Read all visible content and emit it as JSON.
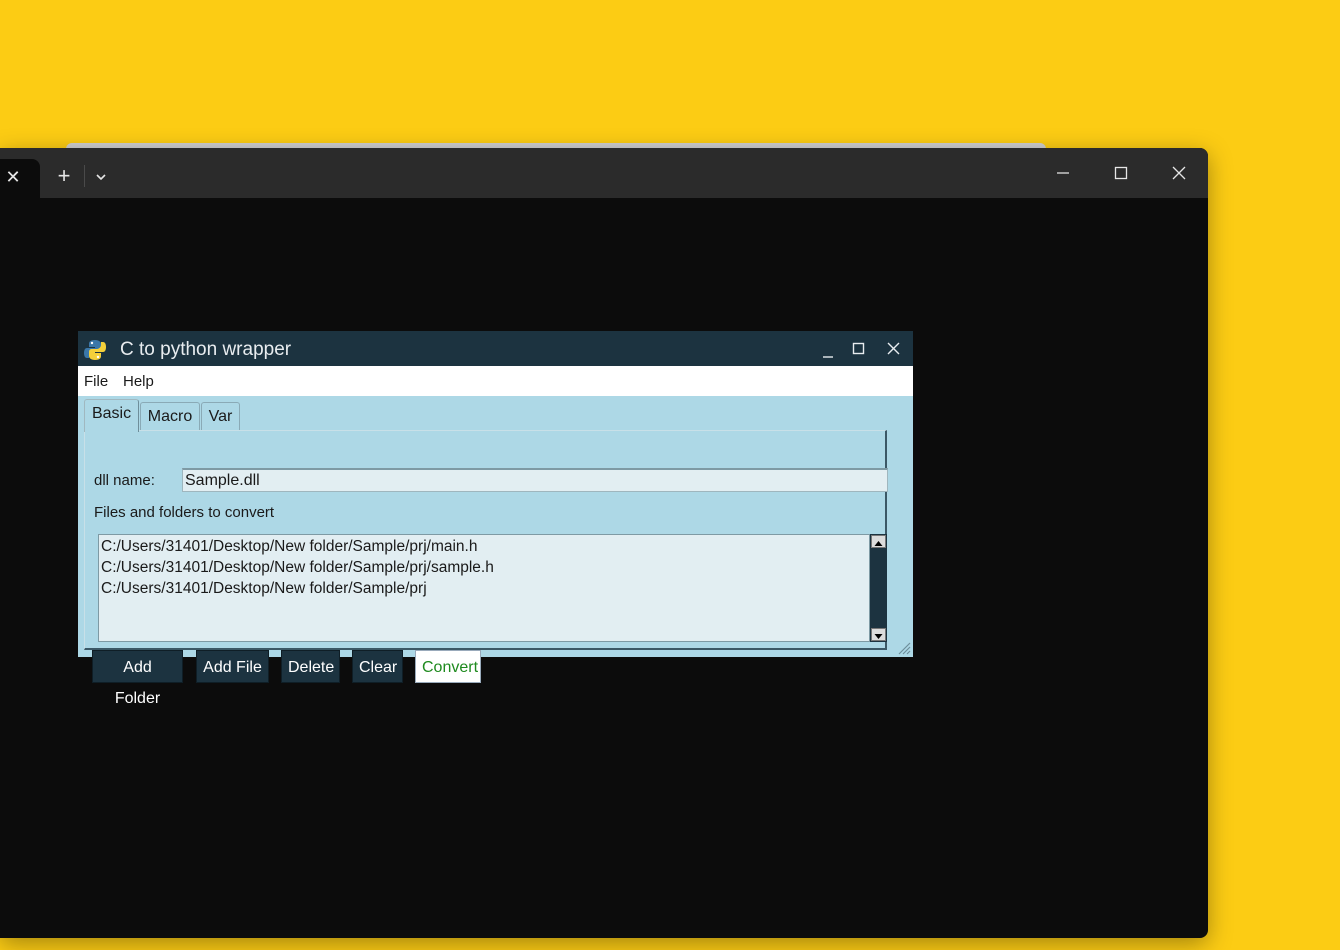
{
  "terminal": {
    "tab_close_glyph": "✕",
    "new_tab_glyph": "+",
    "controls": [
      "minimize-icon",
      "maximize-icon",
      "close-icon"
    ]
  },
  "app": {
    "title": "C to python wrapper",
    "menu": [
      "File",
      "Help"
    ],
    "tabs": [
      "Basic",
      "Macro",
      "Var"
    ],
    "active_tab": "Basic",
    "dll_label": "dll name:",
    "dll_value": "Sample.dll",
    "files_label": "Files and folders to convert",
    "files": [
      "C:/Users/31401/Desktop/New folder/Sample/prj/main.h",
      "C:/Users/31401/Desktop/New folder/Sample/prj/sample.h",
      "C:/Users/31401/Desktop/New folder/Sample/prj"
    ],
    "buttons": [
      "Add Folder",
      "Add File",
      "Delete",
      "Clear",
      "Convert"
    ]
  },
  "colors": {
    "desktop": "#fccc14",
    "app_bg": "#add8e6",
    "app_title_bar": "#1c3340",
    "convert_text": "#1e8a1e"
  }
}
